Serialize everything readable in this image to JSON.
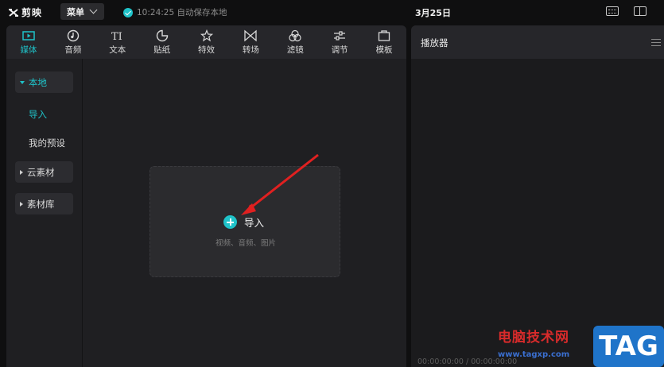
{
  "app": {
    "name": "剪映",
    "menu_label": "菜单",
    "autosave_text": "10:24:25 自动保存本地",
    "project_title": "3月25日"
  },
  "tabs": [
    {
      "label": "媒体",
      "icon": "media-icon",
      "active": true
    },
    {
      "label": "音频",
      "icon": "audio-icon"
    },
    {
      "label": "文本",
      "icon": "text-icon"
    },
    {
      "label": "贴纸",
      "icon": "sticker-icon"
    },
    {
      "label": "特效",
      "icon": "effects-icon"
    },
    {
      "label": "转场",
      "icon": "transition-icon"
    },
    {
      "label": "滤镜",
      "icon": "filter-icon"
    },
    {
      "label": "调节",
      "icon": "adjust-icon"
    },
    {
      "label": "模板",
      "icon": "template-icon"
    }
  ],
  "sidebar": {
    "local": "本地",
    "import": "导入",
    "presets": "我的预设",
    "cloud": "云素材",
    "library": "素材库"
  },
  "dropzone": {
    "import_label": "导入",
    "hint": "视频、音频、图片"
  },
  "player": {
    "title": "播放器",
    "timecode": "00:00:00:00 / 00:00:00:00"
  },
  "watermark": {
    "site_name": "电脑技术网",
    "url": "www.tagxp.com",
    "badge": "TAG"
  },
  "colors": {
    "accent": "#1fc3c9",
    "arrow": "#e02020",
    "background": "#0f0f10",
    "panel": "#1f1f22"
  }
}
